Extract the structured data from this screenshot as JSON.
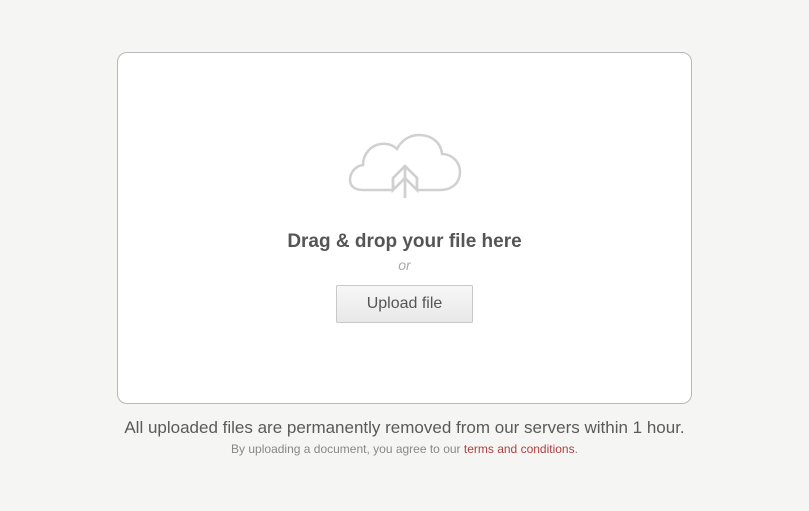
{
  "dropzone": {
    "heading": "Drag & drop your file here",
    "or": "or",
    "upload_button": "Upload file"
  },
  "footer": {
    "notice": "All uploaded files are permanently removed from our servers within 1 hour.",
    "agreement_prefix": "By uploading a document, you agree to our ",
    "terms_link": "terms and conditions",
    "agreement_suffix": "."
  }
}
